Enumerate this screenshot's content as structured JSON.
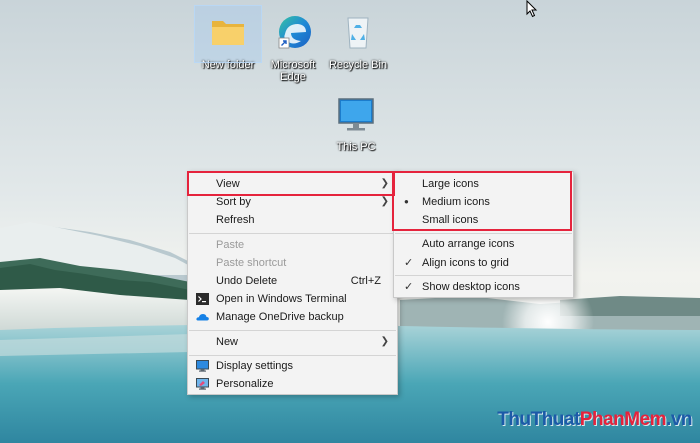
{
  "desktop": {
    "icons": [
      {
        "label": "New folder"
      },
      {
        "label": "Microsoft Edge"
      },
      {
        "label": "Recycle Bin"
      },
      {
        "label": "This PC"
      }
    ]
  },
  "context_menu": {
    "items": {
      "view": "View",
      "sort_by": "Sort by",
      "refresh": "Refresh",
      "paste": "Paste",
      "paste_shortcut": "Paste shortcut",
      "undo_delete": "Undo Delete",
      "undo_shortcut": "Ctrl+Z",
      "terminal": "Open in Windows Terminal",
      "onedrive": "Manage OneDrive backup",
      "new": "New",
      "display": "Display settings",
      "personalize": "Personalize"
    }
  },
  "view_submenu": {
    "large": "Large icons",
    "medium": "Medium icons",
    "small": "Small icons",
    "auto_arrange": "Auto arrange icons",
    "align_grid": "Align icons to grid",
    "show_desktop": "Show desktop icons",
    "bullet": "●",
    "check": "✓"
  },
  "watermark": {
    "a": "ThuThuat",
    "b": "PhanMem",
    "c": ".vn"
  },
  "colors": {
    "highlight_border": "#e5233c",
    "watermark_blue": "#1c5aa8",
    "watermark_red": "#e5233c"
  }
}
